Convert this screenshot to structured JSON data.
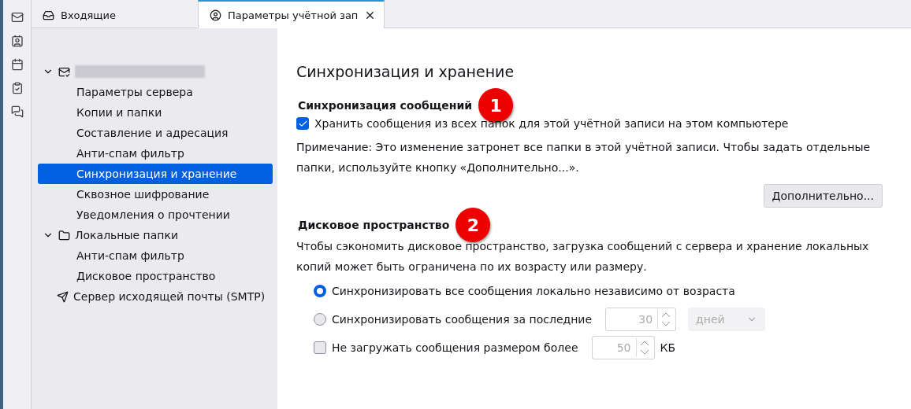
{
  "tabs": [
    {
      "label": "Входящие",
      "kind": "mail",
      "selected": false,
      "closable": false
    },
    {
      "label": "Параметры учётной зап",
      "kind": "account",
      "selected": true,
      "closable": true
    }
  ],
  "sidebar": {
    "items": [
      {
        "kind": "account",
        "redacted": true,
        "selected": false,
        "expanded": true,
        "children": [
          {
            "label": "Параметры сервера",
            "selected": false
          },
          {
            "label": "Копии и папки",
            "selected": false
          },
          {
            "label": "Составление и адресация",
            "selected": false
          },
          {
            "label": "Анти-спам фильтр",
            "selected": false
          },
          {
            "label": "Синхронизация и хранение",
            "selected": true
          },
          {
            "label": "Сквозное шифрование",
            "selected": false
          },
          {
            "label": "Уведомления о прочтении",
            "selected": false
          }
        ]
      },
      {
        "label": "Локальные папки",
        "kind": "folder",
        "selected": false,
        "expanded": true,
        "children": [
          {
            "label": "Анти-спам фильтр",
            "selected": false
          },
          {
            "label": "Дисковое пространство",
            "selected": false
          }
        ]
      },
      {
        "label": "Сервер исходящей почты (SMTP)",
        "kind": "smtp",
        "selected": false
      }
    ]
  },
  "page": {
    "title": "Синхронизация и хранение",
    "sync": {
      "heading": "Синхронизация сообщений",
      "badge": "1",
      "option": {
        "label": "Хранить сообщения из всех папок для этой учётной записи на этом компьютере",
        "checked": true
      },
      "note": "Примечание: Это изменение затронет все папки в этой учётной записи. Чтобы задать отдельные папки, используйте кнопку «Дополнительно...».",
      "button": "Дополнительно..."
    },
    "disk": {
      "heading": "Дисковое пространство",
      "badge": "2",
      "description": "Чтобы сэкономить дисковое пространство, загрузка сообщений с сервера и хранение локальных копий может быть ограничена по их возрасту или размеру.",
      "options": [
        {
          "kind": "radio",
          "label": "Синхронизировать все сообщения локально независимо от возраста",
          "selected": true
        },
        {
          "kind": "radio",
          "label": "Синхронизировать сообщения за последние",
          "selected": false,
          "value": "30",
          "unit_select": "дней",
          "disabled": true
        },
        {
          "kind": "checkbox",
          "label": "Не загружать сообщения размером более",
          "checked": false,
          "value": "50",
          "unit": "КБ",
          "disabled": true
        }
      ]
    }
  }
}
